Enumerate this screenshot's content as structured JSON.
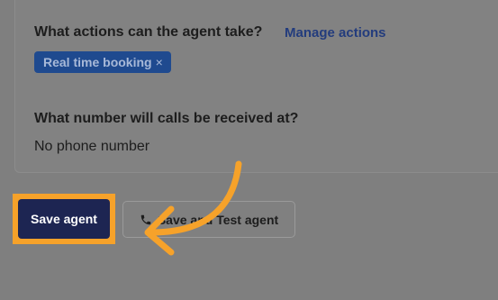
{
  "actions": {
    "question": "What actions can the agent take?",
    "manage_link": "Manage actions",
    "chips": [
      {
        "label": "Real time booking",
        "remove_symbol": "×"
      }
    ]
  },
  "phone_section": {
    "question": "What number will calls be received at?",
    "value": "No phone number"
  },
  "buttons": {
    "save_label": "Save agent",
    "test_label": "Save and Test agent",
    "test_icon": "phone-icon"
  },
  "colors": {
    "annotation": "#f6a22a",
    "primary_button": "#1d2552",
    "chip": "#1f4a8f",
    "link": "#233c7d"
  }
}
